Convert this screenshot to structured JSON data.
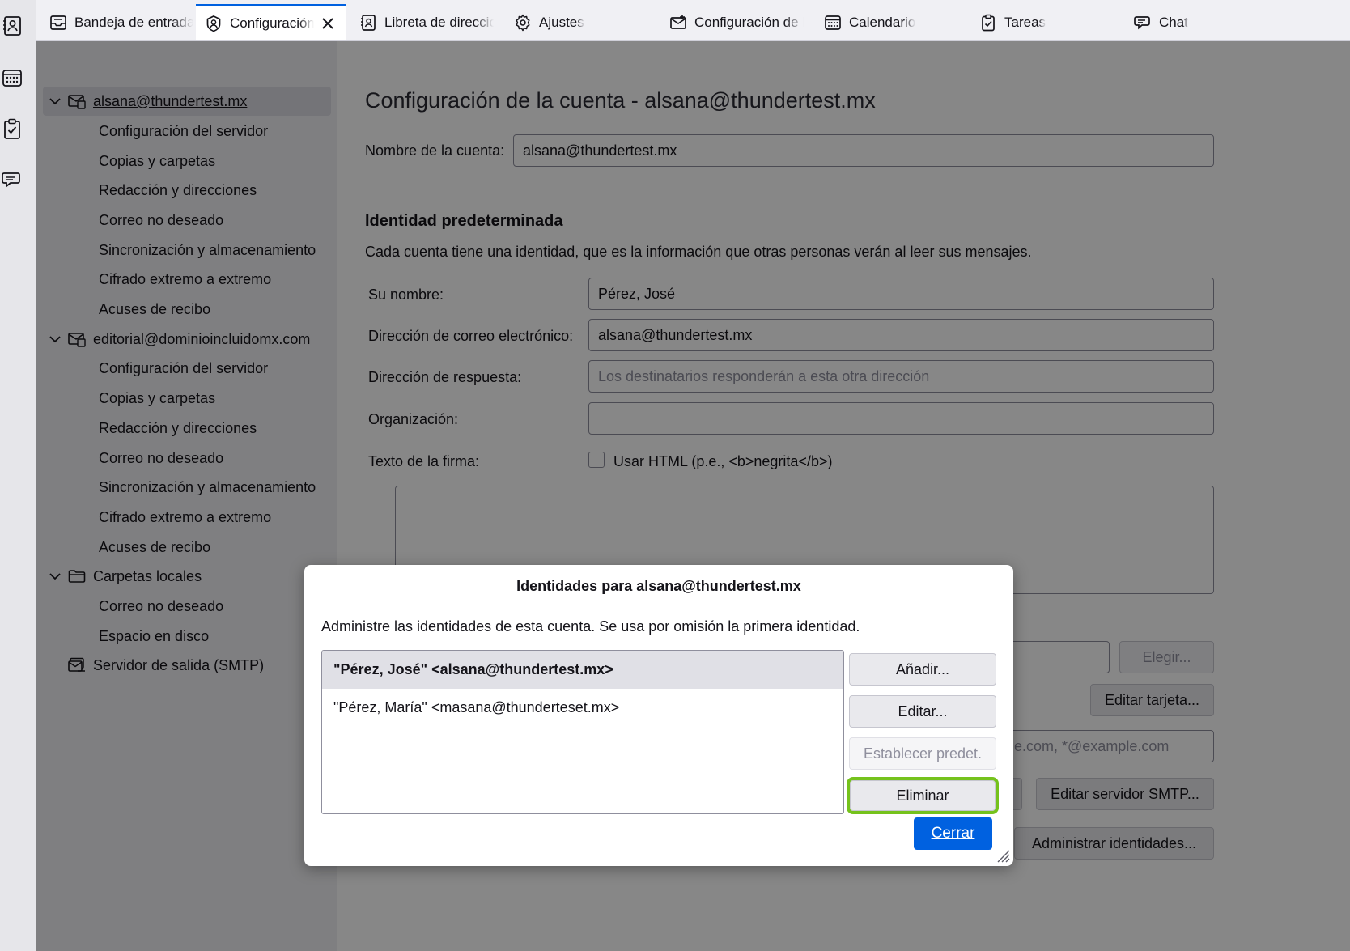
{
  "tabs": [
    {
      "label": "Bandeja de entrada",
      "icon": "inbox-icon"
    },
    {
      "label": "Configuración de la cuenta",
      "icon": "account-settings-icon",
      "active": true
    },
    {
      "label": "Libreta de direcciones",
      "icon": "address-book-icon"
    },
    {
      "label": "Ajustes",
      "icon": "gear-icon"
    },
    {
      "label": "Configuración de la cuenta",
      "icon": "account-setup-icon"
    },
    {
      "label": "Calendario",
      "icon": "calendar-icon"
    },
    {
      "label": "Tareas",
      "icon": "tasks-icon"
    },
    {
      "label": "Chat",
      "icon": "chat-icon"
    }
  ],
  "spaces": [
    "address-book-icon",
    "calendar-icon",
    "tasks-icon",
    "chat-icon"
  ],
  "sidebar": {
    "account1": {
      "email": "alsana@thundertest.mx",
      "items": [
        "Configuración del servidor",
        "Copias y carpetas",
        "Redacción y direcciones",
        "Correo no deseado",
        "Sincronización y almacenamiento",
        "Cifrado extremo a extremo",
        "Acuses de recibo"
      ]
    },
    "account2": {
      "email": "editorial@dominioincluidomx.com",
      "items": [
        "Configuración del servidor",
        "Copias y carpetas",
        "Redacción y direcciones",
        "Correo no deseado",
        "Sincronización y almacenamiento",
        "Cifrado extremo a extremo",
        "Acuses de recibo"
      ]
    },
    "local": {
      "label": "Carpetas locales",
      "items": [
        "Correo no deseado",
        "Espacio en disco"
      ]
    },
    "smtp": "Servidor de salida (SMTP)"
  },
  "main": {
    "title": "Configuración de la cuenta - alsana@thundertest.mx",
    "account_name_label": "Nombre de la cuenta:",
    "account_name_value": "alsana@thundertest.mx",
    "identity_heading": "Identidad predeterminada",
    "identity_desc": "Cada cuenta tiene una identidad, que es la información que otras personas verán al leer sus mensajes.",
    "name_label": "Su nombre:",
    "name_value": "Pérez, José",
    "email_label": "Dirección de correo electrónico:",
    "email_value": "alsana@thundertest.mx",
    "reply_label": "Dirección de respuesta:",
    "reply_placeholder": "Los destinatarios responderán a esta otra dirección",
    "org_label": "Organización:",
    "org_value": "",
    "sig_label": "Texto de la firma:",
    "html_checkbox_label": "Usar HTML (p.e., <b>negrita</b>)",
    "choose_button": "Elegir...",
    "edit_card_button": "Editar tarjeta...",
    "smtp_example_tail": "le.com, *@example.com",
    "edit_smtp_button": "Editar servidor SMTP...",
    "manage_identities_button": "Administrar identidades..."
  },
  "dialog": {
    "title": "Identidades para alsana@thundertest.mx",
    "description": "Administre las identidades de esta cuenta. Se usa por omisión la primera identidad.",
    "identities": [
      "\"Pérez, José\" <alsana@thundertest.mx>",
      "\"Pérez, María\" <masana@thunderteset.mx>"
    ],
    "buttons": {
      "add": "Añadir...",
      "edit": "Editar...",
      "set_default": "Establecer predet.",
      "delete": "Eliminar",
      "close": "Cerrar"
    }
  },
  "colors": {
    "accent": "#0061e0",
    "focus_ring": "#75c21c",
    "overlay": "rgba(0,0,0,0.47)"
  }
}
